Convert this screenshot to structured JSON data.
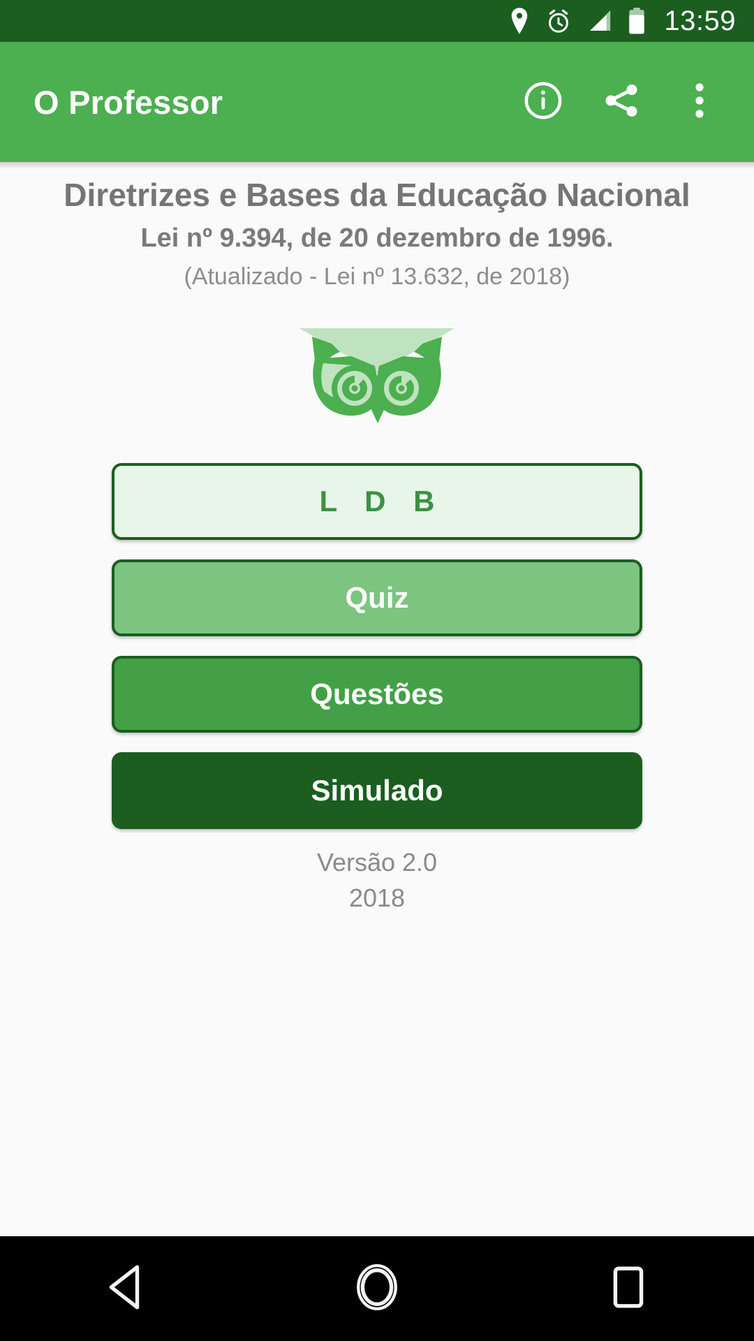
{
  "status_bar": {
    "time": "13:59",
    "background_color": "#1b5e20",
    "icons": [
      {
        "name": "location-pin-icon"
      },
      {
        "name": "alarm-clock-icon"
      },
      {
        "name": "cellular-signal-icon"
      },
      {
        "name": "battery-icon"
      }
    ]
  },
  "app_bar": {
    "title": "O Professor",
    "background_color": "#4caf50",
    "title_color": "#ffffff",
    "actions": [
      {
        "name": "info-icon",
        "label": "Informações"
      },
      {
        "name": "share-icon",
        "label": "Compartilhar"
      },
      {
        "name": "overflow-menu-icon",
        "label": "Mais opções"
      }
    ]
  },
  "header": {
    "law_title": "Diretrizes e Bases da Educação Nacional",
    "law_number": "Lei nº 9.394, de 20 dezembro de 1996.",
    "law_update": "(Atualizado - Lei nº 13.632, de 2018)",
    "title_color": "#757575"
  },
  "logo": {
    "name": "owl-logo",
    "light_color": "#bfe3bf",
    "dark_color": "#4caf50"
  },
  "menu": {
    "buttons": [
      {
        "id": "ldb",
        "label": "L D B",
        "background": "#e8f5e9",
        "text_color": "#3c9143",
        "border": "#1b5e20"
      },
      {
        "id": "quiz",
        "label": "Quiz",
        "background": "#7cc47f",
        "text_color": "#ffffff",
        "border": "#1b5e20"
      },
      {
        "id": "questoes",
        "label": "Questões",
        "background": "#43a047",
        "text_color": "#ffffff",
        "border": "#1b5e20"
      },
      {
        "id": "simulado",
        "label": "Simulado",
        "background": "#1b5e20",
        "text_color": "#ffffff",
        "border": "#1b5e20"
      }
    ]
  },
  "footer": {
    "version": "Versão 2.0",
    "year": "2018",
    "text_color": "#8a8a8a"
  },
  "nav_bar": {
    "background_color": "#000000",
    "buttons": [
      {
        "name": "back-button",
        "label": "Voltar"
      },
      {
        "name": "home-button",
        "label": "Início"
      },
      {
        "name": "recents-button",
        "label": "Recentes"
      }
    ]
  }
}
